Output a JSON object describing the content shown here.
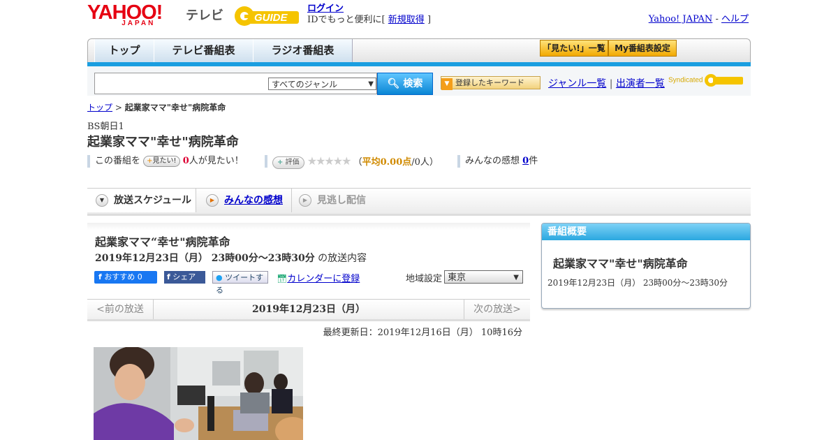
{
  "header": {
    "logo_yahoo": "YAHOO!",
    "logo_japan": "JAPAN",
    "logo_tv": "テレビ",
    "gguide": "GUIDE",
    "login": "ログイン",
    "id_text": "IDでもっと便利に[",
    "register": "新規取得",
    "id_text_end": "]",
    "yahoo_japan": "Yahoo! JAPAN",
    "sep": " - ",
    "help": "ヘルプ"
  },
  "nav": {
    "tabs": [
      "トップ",
      "テレビ番組表",
      "ラジオ番組表"
    ],
    "mitai_list": "「見たい!」一覧",
    "my_bangumi": "My番組表設定"
  },
  "search": {
    "genre": "すべてのジャンル",
    "button": "検索",
    "keyword_btn": "登録したキーワード",
    "genre_list": "ジャンル一覧",
    "divider": "|",
    "performer_list": "出演者一覧",
    "syndicated": "Syndicated"
  },
  "breadcrumb": {
    "top": "トップ",
    "sep": " > ",
    "current": "起業家ママ\"幸せ\"病院革命"
  },
  "program": {
    "channel": "BS朝日1",
    "title": "起業家ママ\"幸せ\"病院革命",
    "this_program": "この番組を",
    "mitai_btn": "見たい!",
    "mitai_count": "0",
    "mitai_suffix": "人が見たい！",
    "hyoka_btn": "評価",
    "stars": "★★★★★",
    "avg_prefix": "（",
    "avg": "平均0.00点",
    "avg_suffix": "/0人）",
    "kansou": "みんなの感想",
    "kansou_count": "0",
    "kansou_suffix": "件"
  },
  "subtabs": [
    "放送スケジュール",
    "みんなの感想",
    "見逃し配信"
  ],
  "broadcast": {
    "title": "起業家ママ“幸せ\"病院革命",
    "date_time": "2019年12月23日（月） 23時00分～23時30分",
    "date_suffix": " の放送内容",
    "fb_recommend": "おすすめ 0",
    "fb_share": "シェア",
    "tweet": "ツイートする",
    "calendar": "カレンダーに登録",
    "region_label": "地域設定",
    "region": "東京",
    "prev": "<前の放送",
    "current_date": "2019年12月23日（月）",
    "next": "次の放送>",
    "updated": "最終更新日：2019年12月16日（月） 10時16分"
  },
  "side": {
    "heading": "番組概要",
    "title": "起業家ママ\"幸せ\"病院革命",
    "date": "2019年12月23日（月） 23時00分～23時30分"
  },
  "colors": {
    "accent_blue": "#1a9ee0",
    "yahoo_red": "#e60012",
    "gguide_yellow": "#f5c400"
  }
}
